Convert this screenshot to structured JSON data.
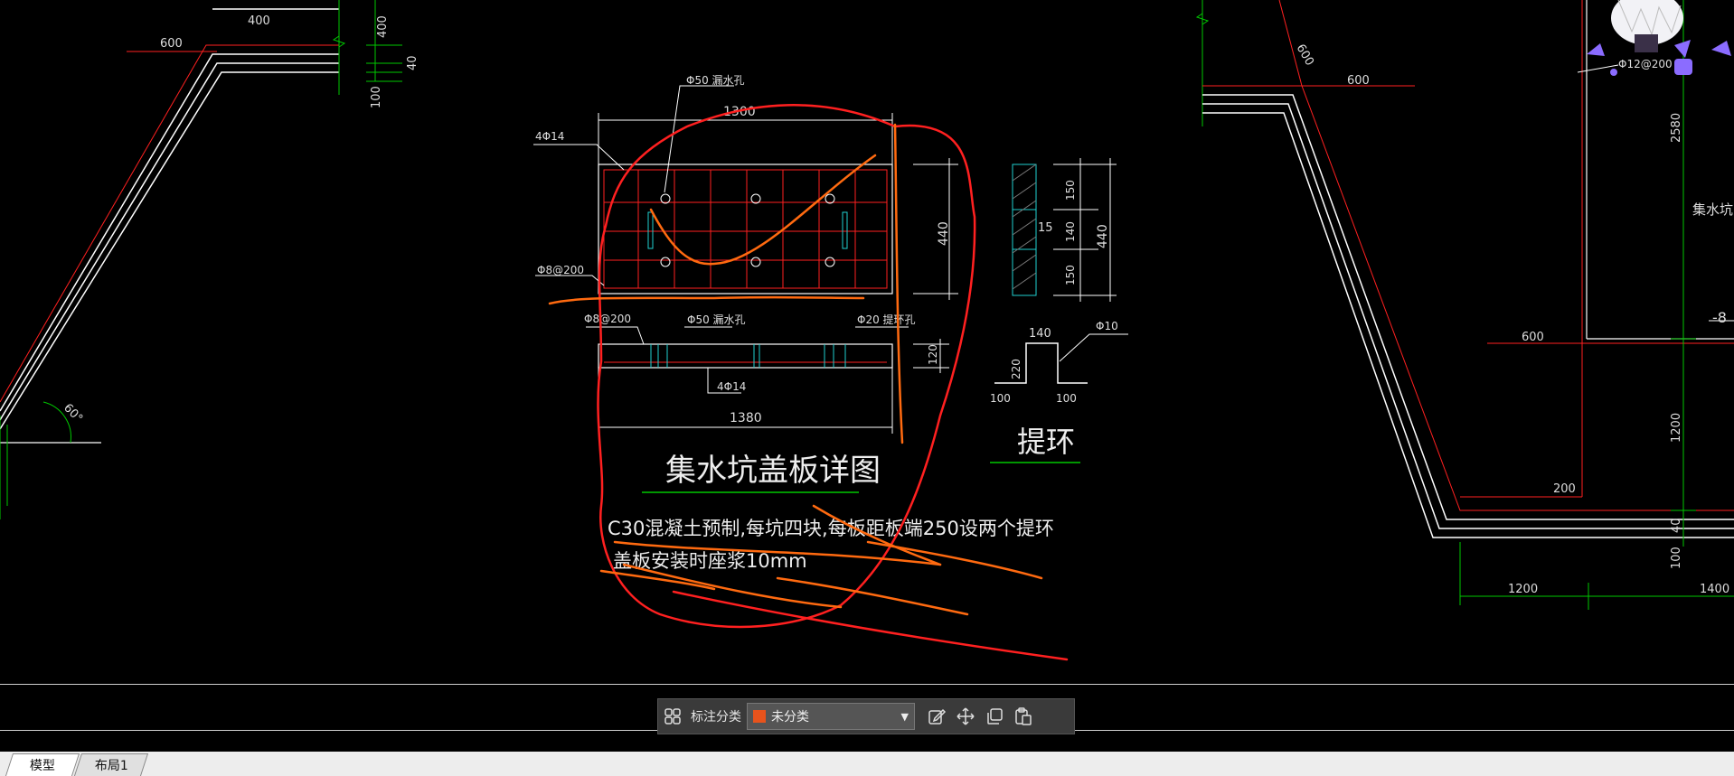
{
  "drawing": {
    "title": "集水坑盖板详图",
    "note_line1": "C30混凝土预制,每坑四块,每板距板端250设两个提环",
    "note_line2": "盖板安装时座浆10mm",
    "hook_title": "提环",
    "dims": {
      "d400_top": "400",
      "d600_top_left": "600",
      "d400_vert": "400",
      "d40_vert": "40",
      "d100_vert": "100",
      "angle": "60°",
      "d1300": "1300",
      "d1380": "1380",
      "d440_plan": "440",
      "d120": "120",
      "d150a": "150",
      "d140": "140",
      "d150b": "150",
      "d440_hook": "440",
      "d15": "15",
      "d140_hook": "140",
      "d220": "220",
      "d100_l": "100",
      "d100_r": "100",
      "d600_right": "600",
      "d600_diag": "600",
      "d2580": "2580",
      "d600_mid": "600",
      "d1200_vert": "1200",
      "d200": "200",
      "d40_right": "40",
      "d100_right": "100",
      "d1200_bottom": "1200",
      "d1400_bottom": "1400",
      "minus8": "-8"
    },
    "labels": {
      "drain_hole_top": "Φ50  漏水孔",
      "rebar_4phi14_top": "4Φ14",
      "rebar_phi8_plan": "Φ8@200",
      "rebar_phi8_section": "Φ8@200",
      "drain_hole_section": "Φ50  漏水孔",
      "lift_hole": "Φ20  提环孔",
      "rebar_4phi14_bottom": "4Φ14",
      "hook_rebar": "Φ10",
      "right_rebar": "Φ12@200",
      "sump_label": "集水坑"
    }
  },
  "toolbar": {
    "category_label": "标注分类",
    "category_value": "未分类",
    "swatch_color": "#e8531c",
    "icons": [
      "grid-icon",
      "edit-icon",
      "move-icon",
      "copy-icon",
      "paste-icon"
    ]
  },
  "tabs": {
    "model": "模型",
    "layout": "布局1"
  },
  "colors": {
    "background": "#000000",
    "outline": "#ffffff",
    "rebar": "#ff2020",
    "dimension": "#00c800",
    "markup": "#ff3020",
    "markup_orange": "#ff6a10",
    "cyan": "#20d0d0"
  }
}
